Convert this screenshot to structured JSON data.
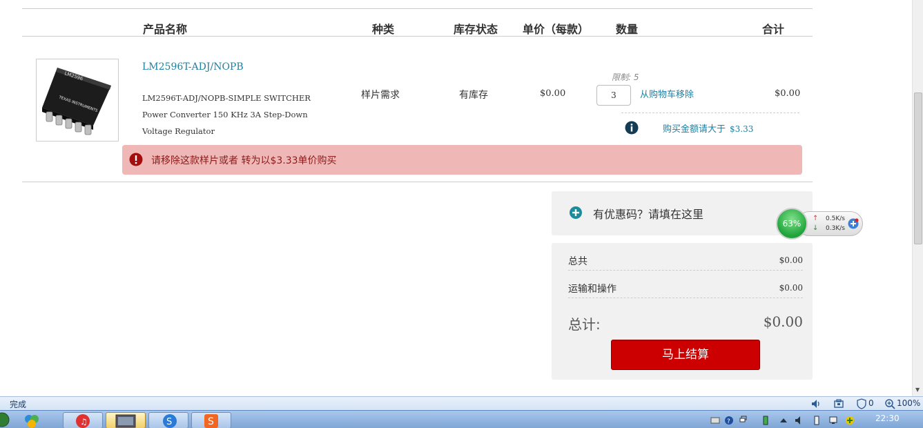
{
  "table": {
    "headers": [
      "产品名称",
      "种类",
      "库存状态",
      "单价（每款）",
      "数量",
      "合计"
    ]
  },
  "item": {
    "image_chip_label": "LM2596",
    "image_logo": "TEXAS INSTRUMENTS",
    "name_link": "LM2596T-ADJ/NOPB",
    "desc_line1": "LM2596T-ADJ/NOPB-SIMPLE SWITCHER",
    "desc_line2": "Power Converter 150 KHz 3A Step-Down",
    "desc_line3": "Voltage Regulator",
    "type": "样片需求",
    "stock": "有库存",
    "unit_price": "$0.00",
    "limit": "限制: 5",
    "quantity": "3",
    "remove_label": "从购物车移除",
    "total": "$0.00",
    "min_purchase_label": "购买金额请大于",
    "min_purchase_amount": "$3.33"
  },
  "error": {
    "message": "请移除这款样片或者 转为以$3.33单价购买"
  },
  "coupon": {
    "label": "有优惠码？请填在这里"
  },
  "summary": {
    "subtotal_label": "总共",
    "subtotal_value": "$0.00",
    "shipping_label": "运输和操作",
    "shipping_value": "$0.00",
    "grand_label": "总计:",
    "grand_value": "$0.00",
    "checkout_label": "马上结算"
  },
  "net_widget": {
    "percent": "63%",
    "upload": "0.5K/s",
    "download": "0.3K/s"
  },
  "statusbar": {
    "status": "完成",
    "popups_blocked": "0",
    "zoom": "100%"
  },
  "taskbar": {
    "clock": "22:30"
  },
  "colors": {
    "link": "#1e7fa0",
    "error_bg": "#f0b7b7",
    "error_text": "#8b1a1a",
    "checkout": "#cc0000"
  }
}
